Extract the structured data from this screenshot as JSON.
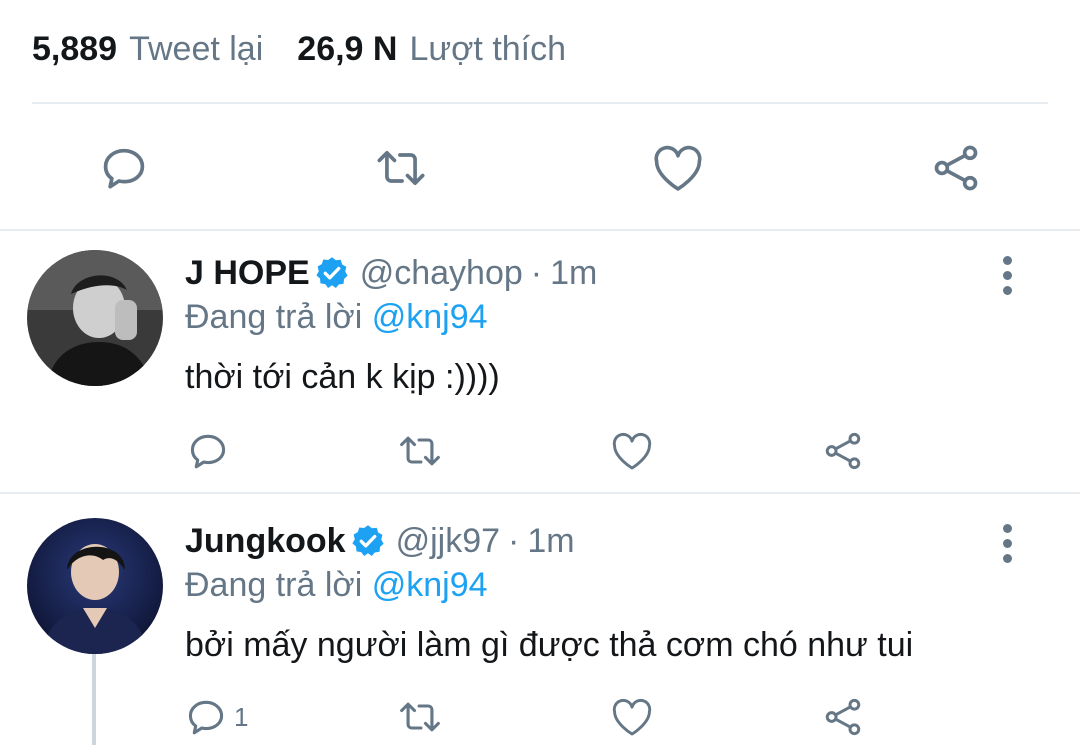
{
  "stats": {
    "retweets_count": "5,889",
    "retweets_label": "Tweet lại",
    "likes_count": "26,9 N",
    "likes_label": "Lượt thích"
  },
  "main_actions": [
    "reply-icon",
    "retweet-icon",
    "like-icon",
    "share-icon"
  ],
  "colors": {
    "text": "#14171a",
    "muted": "#657786",
    "accent": "#1da1f2",
    "divider": "#e6ecf0"
  },
  "replies": [
    {
      "name": "J HOPE",
      "handle": "@chayhop",
      "separator": "·",
      "time": "1m",
      "replying_prefix": "Đang trả lời",
      "replying_to": "@knj94",
      "text": "thời tới cản k kịp :))))",
      "reply_count": ""
    },
    {
      "name": "Jungkook",
      "handle": "@jjk97",
      "separator": "·",
      "time": "1m",
      "replying_prefix": "Đang trả lời",
      "replying_to": "@knj94",
      "text": "bởi mấy người làm gì được thả cơm chó như tui",
      "reply_count": "1"
    }
  ]
}
